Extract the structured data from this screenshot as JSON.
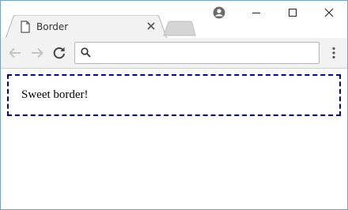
{
  "window": {
    "title_tab": "Border",
    "controls": [
      "minimize",
      "maximize",
      "close"
    ]
  },
  "toolbar": {
    "address_value": "",
    "address_placeholder": ""
  },
  "page": {
    "box_text": "Sweet border!",
    "border_color": "#0000aa",
    "border_style": "dashed"
  },
  "colors": {
    "accent": "#6fa3d8",
    "tab_bg": "#f2f2f2"
  },
  "icons": {
    "tab": "page-icon",
    "back": "back-arrow-icon",
    "forward": "forward-arrow-icon",
    "reload": "reload-icon",
    "search": "search-icon",
    "menu": "kebab-menu-icon",
    "profile": "profile-icon"
  }
}
